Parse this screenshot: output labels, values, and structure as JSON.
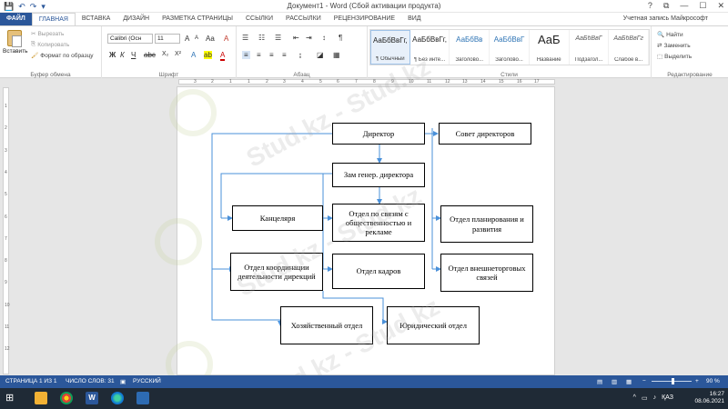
{
  "window": {
    "title": "Документ1 - Word (Сбой активации продукта)",
    "help": "?",
    "restore": "⧉",
    "minimize": "—",
    "maximize": "☐",
    "close": "✕"
  },
  "quick_access": {
    "save": "💾",
    "undo": "↶",
    "redo": "↷",
    "customize": "▾"
  },
  "tabs": [
    "ФАЙЛ",
    "ГЛАВНАЯ",
    "ВСТАВКА",
    "ДИЗАЙН",
    "РАЗМЕТКА СТРАНИЦЫ",
    "ССЫЛКИ",
    "РАССЫЛКИ",
    "РЕЦЕНЗИРОВАНИЕ",
    "ВИД"
  ],
  "account": "Учетная запись Майкрософт",
  "clipboard": {
    "paste": "Вставить",
    "cut": "Вырезать",
    "copy": "Копировать",
    "format_painter": "Формат по образцу",
    "group_label": "Буфер обмена"
  },
  "font": {
    "name": "Calibri (Осн",
    "size": "11",
    "group_label": "Шрифт",
    "bold": "Ж",
    "italic": "К",
    "underline": "Ч",
    "grow": "A",
    "shrink": "A",
    "case": "Aa",
    "clear": "A",
    "highlight": "ab",
    "color": "A"
  },
  "paragraph": {
    "group_label": "Абзац",
    "pilcrow": "¶"
  },
  "styles": {
    "group_label": "Стили",
    "items": [
      {
        "preview": "АаБбВвГг,",
        "name": "¶ Обычный"
      },
      {
        "preview": "АаБбВвГг,",
        "name": "¶ Без инте..."
      },
      {
        "preview": "АаБбВв",
        "name": "Заголово..."
      },
      {
        "preview": "АаБбВвГ",
        "name": "Заголово..."
      },
      {
        "preview": "АаБ",
        "name": "Название"
      },
      {
        "preview": "АаБбВвГ",
        "name": "Подзагол..."
      },
      {
        "preview": "АаБбВвГг",
        "name": "Слабое в..."
      }
    ]
  },
  "editing": {
    "find": "Найти",
    "replace": "Заменить",
    "select": "Выделить",
    "group_label": "Редактирование"
  },
  "ruler": {
    "h_numbers": [
      "3",
      "2",
      "1",
      "1",
      "2",
      "3",
      "4",
      "5",
      "6",
      "7",
      "8",
      "9",
      "10",
      "11",
      "12",
      "13",
      "14",
      "15",
      "16",
      "17"
    ],
    "v_numbers": [
      "1",
      "2",
      "3",
      "4",
      "5",
      "6",
      "7",
      "8",
      "9",
      "10",
      "11",
      "12"
    ]
  },
  "org_chart": {
    "director": "Директор",
    "board": "Совет директоров",
    "deputy": "Зам генер. директора",
    "office": "Канцеляря",
    "pr": "Отдел по связям с общественностью и рекламе",
    "planning": "Отдел планирования и развития",
    "coordination": "Отдел координации деятельности дирекций",
    "hr": "Отдел кадров",
    "foreign": "Отдел внешнеторговых связей",
    "household": "Хозяйственный отдел",
    "legal": "Юридический отдел"
  },
  "watermark": {
    "text": "Stud.kz - Stud.kz"
  },
  "status_bar": {
    "page": "СТРАНИЦА 1 ИЗ 1",
    "words": "ЧИСЛО СЛОВ: 31",
    "lang": "РУССКИЙ",
    "zoom": "90 %",
    "zoom_minus": "−",
    "zoom_plus": "+"
  },
  "taskbar": {
    "lang": "ҚАЗ",
    "time": "16:27",
    "date": "08.06.2021"
  },
  "colors": {
    "accent": "#2b579a",
    "taskbar": "#1f2a36",
    "connector": "#4a90d9"
  }
}
